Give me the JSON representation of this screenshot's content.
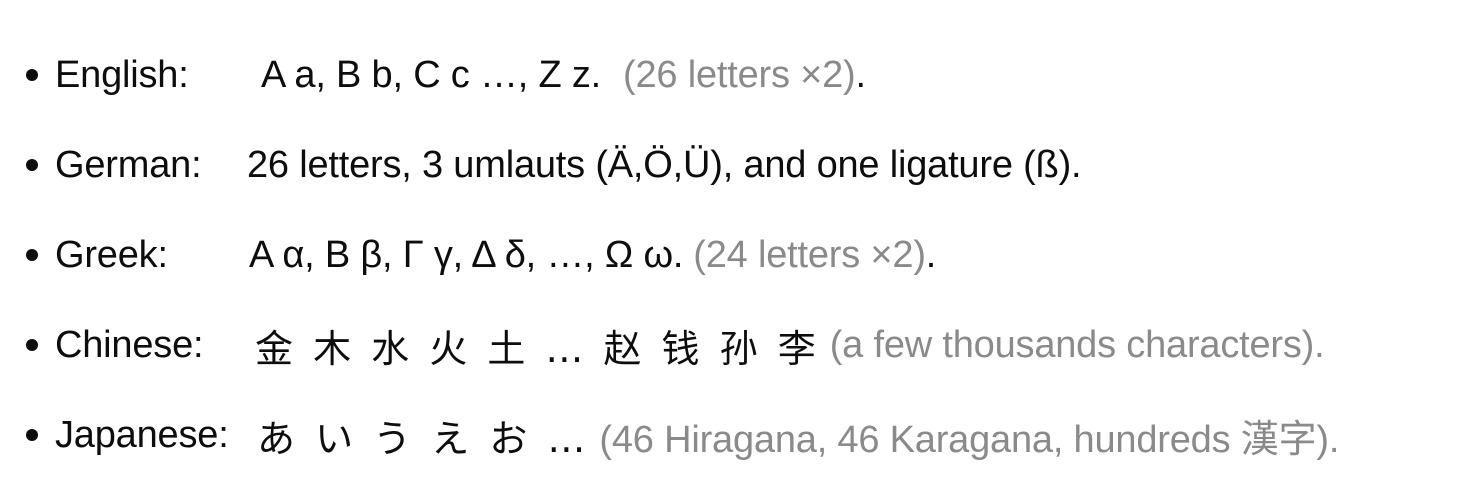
{
  "items": [
    {
      "label": "English:",
      "content": "A a, B b, C c …, Z z.",
      "note": "(26 letters ×2)",
      "end": "."
    },
    {
      "label": "German:",
      "content": "26 letters, 3 umlauts (Ä,Ö,Ü), and one ligature (ß).",
      "note": "",
      "end": ""
    },
    {
      "label": "Greek:",
      "content": "Α α, Β β, Γ γ, Δ δ, …, Ω ω.",
      "note": "(24 letters ×2)",
      "end": "."
    },
    {
      "label": "Chinese:",
      "content": "金 木 水 火 土 … 赵 钱 孙 李",
      "note": "(a few thousands characters).",
      "end": ""
    },
    {
      "label": "Japanese:",
      "content": "あ い う え お …",
      "note": "(46 Hiragana, 46 Karagana, hundreds 漢字).",
      "end": ""
    }
  ]
}
